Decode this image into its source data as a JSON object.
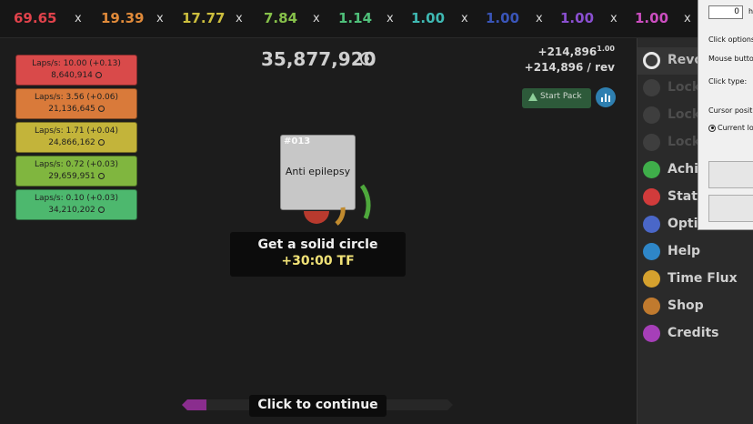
{
  "multipliers": [
    {
      "value": "69.65",
      "color": "#e0424b"
    },
    {
      "value": "19.39",
      "color": "#e08a3a"
    },
    {
      "value": "17.77",
      "color": "#cdbf3e"
    },
    {
      "value": "7.84",
      "color": "#86c04a"
    },
    {
      "value": "1.14",
      "color": "#4fc07a"
    },
    {
      "value": "1.00",
      "color": "#3fb9b3"
    },
    {
      "value": "1.00",
      "color": "#3a55b8"
    },
    {
      "value": "1.00",
      "color": "#8a4fd0"
    },
    {
      "value": "1.00",
      "color": "#cc4ec0"
    },
    {
      "value": "1.0",
      "color": "#e0424b"
    }
  ],
  "multiplier_separator": "x",
  "score": "35,877,920",
  "gain_line": "+214,896",
  "gain_superscript": "1.00",
  "rev_line": "+214,896 / rev",
  "start_pack_label": "Start Pack",
  "laps": [
    {
      "rate": "Laps/s: 10.00 (+0.13)",
      "total": "8,640,914",
      "color": "#d94a4a"
    },
    {
      "rate": "Laps/s: 3.56 (+0.06)",
      "total": "21,136,645",
      "color": "#d97a3a"
    },
    {
      "rate": "Laps/s: 1.71 (+0.04)",
      "total": "24,866,162",
      "color": "#c3b43a"
    },
    {
      "rate": "Laps/s: 0.72 (+0.03)",
      "total": "29,659,951",
      "color": "#80b63f"
    },
    {
      "rate": "Laps/s: 0.10 (+0.03)",
      "total": "34,210,202",
      "color": "#4db86e"
    }
  ],
  "card": {
    "number": "#013",
    "name": "Anti epilepsy"
  },
  "reward": {
    "title": "Get a solid circle",
    "bonus": "+30:00 TF"
  },
  "continue_label": "Click to continue",
  "progress_fraction": 0.09,
  "menu": [
    {
      "label": "Revo",
      "state": "active",
      "icon": "revolution-icon",
      "color": "#e8e8e8"
    },
    {
      "label": "Lock",
      "state": "locked",
      "icon": "lock-icon",
      "color": "#3e3e3e"
    },
    {
      "label": "Lock",
      "state": "locked",
      "icon": "lock-icon",
      "color": "#3e3e3e"
    },
    {
      "label": "Lock",
      "state": "locked",
      "icon": "lock-icon",
      "color": "#3e3e3e"
    },
    {
      "label": "Achi",
      "state": "normal",
      "icon": "achievement-icon",
      "color": "#3fae4a"
    },
    {
      "label": "Stati",
      "state": "normal",
      "icon": "stats-icon",
      "color": "#d13b3b"
    },
    {
      "label": "Options",
      "state": "normal",
      "icon": "gear-icon",
      "color": "#4a67c8"
    },
    {
      "label": "Help",
      "state": "normal",
      "icon": "help-icon",
      "color": "#2e86c8"
    },
    {
      "label": "Time Flux",
      "state": "normal",
      "icon": "stopwatch-icon",
      "color": "#d5a12e"
    },
    {
      "label": "Shop",
      "state": "normal",
      "icon": "shop-icon",
      "color": "#c07a2e"
    },
    {
      "label": "Credits",
      "state": "normal",
      "icon": "info-icon",
      "color": "#a63fb8"
    }
  ],
  "dialog": {
    "interval_value": "0",
    "interval_unit": "h",
    "click_options": "Click options",
    "mouse_button": "Mouse butto",
    "click_type": "Click type:",
    "cursor_position": "Cursor positio",
    "current_location": "Current lo"
  }
}
